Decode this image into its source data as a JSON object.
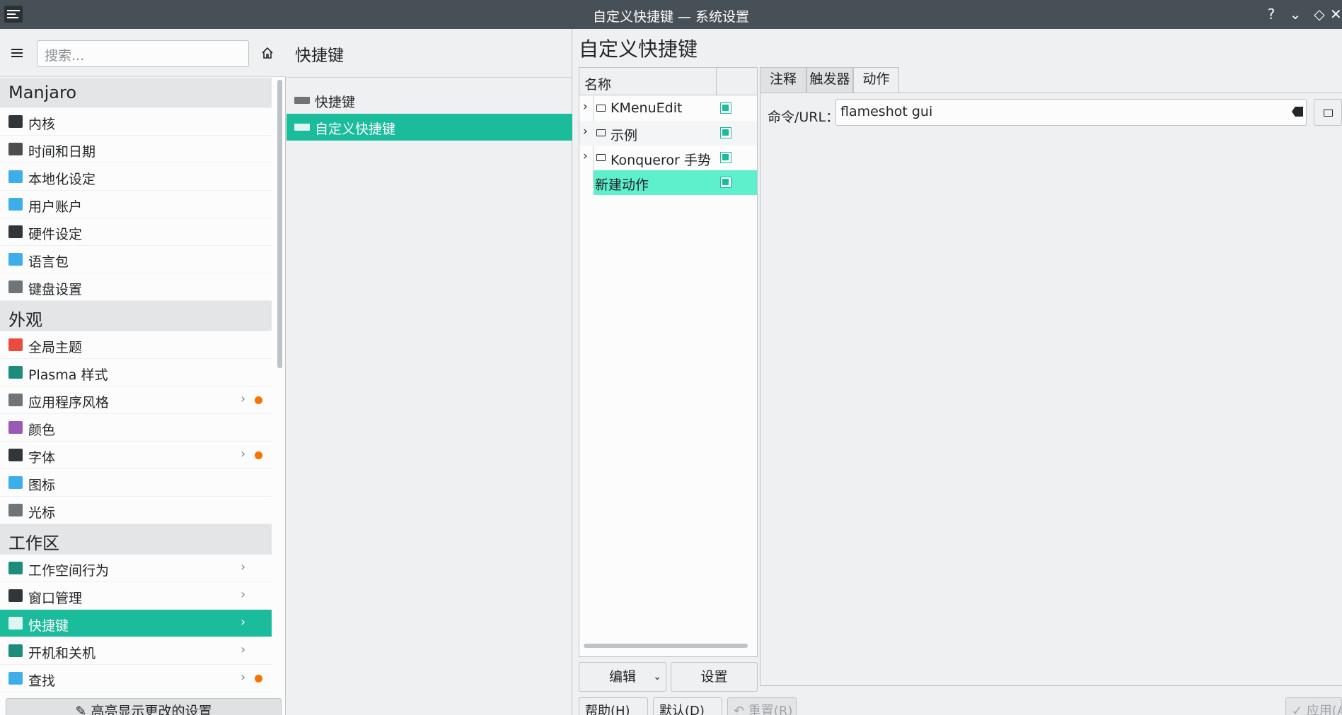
{
  "window": {
    "title": "自定义快捷键 — 系统设置",
    "help_glyph": "?",
    "minimize_glyph": "⌄",
    "maximize_glyph": "◇",
    "close_glyph": "✕"
  },
  "sidebar": {
    "search_placeholder": "搜索...",
    "categories": [
      {
        "title": "Manjaro",
        "items": [
          {
            "label": "内核",
            "icon": "kernel-icon",
            "color": "#31363b"
          },
          {
            "label": "时间和日期",
            "icon": "clock-icon",
            "color": "#4d4d4d"
          },
          {
            "label": "本地化设定",
            "icon": "locale-icon",
            "color": "#3daee9"
          },
          {
            "label": "用户账户",
            "icon": "user-icon",
            "color": "#3daee9"
          },
          {
            "label": "硬件设定",
            "icon": "hardware-icon",
            "color": "#31363b"
          },
          {
            "label": "语言包",
            "icon": "language-icon",
            "color": "#3daee9"
          },
          {
            "label": "键盘设置",
            "icon": "keyboard-icon",
            "color": "#6e7478"
          }
        ]
      },
      {
        "title": "外观",
        "items": [
          {
            "label": "全局主题",
            "icon": "global-theme-icon",
            "color": "#e74c3c"
          },
          {
            "label": "Plasma 样式",
            "icon": "plasma-style-icon",
            "color": "#1d8c7a"
          },
          {
            "label": "应用程序风格",
            "icon": "app-style-icon",
            "color": "#6e7478",
            "chevron": true,
            "dot": true
          },
          {
            "label": "颜色",
            "icon": "colors-icon",
            "color": "#9b59b6"
          },
          {
            "label": "字体",
            "icon": "font-icon",
            "color": "#31363b",
            "chevron": true,
            "dot": true
          },
          {
            "label": "图标",
            "icon": "icons-icon",
            "color": "#3daee9"
          },
          {
            "label": "光标",
            "icon": "cursor-icon",
            "color": "#6e7478"
          }
        ]
      },
      {
        "title": "工作区",
        "items": [
          {
            "label": "工作空间行为",
            "icon": "workspace-icon",
            "color": "#1d8c7a",
            "chevron": true
          },
          {
            "label": "窗口管理",
            "icon": "window-icon",
            "color": "#31363b",
            "chevron": true
          },
          {
            "label": "快捷键",
            "icon": "shortcuts-icon",
            "color": "#dff5ef",
            "chevron": true,
            "selected": true
          },
          {
            "label": "开机和关机",
            "icon": "startup-icon",
            "color": "#1d8c7a",
            "chevron": true
          },
          {
            "label": "查找",
            "icon": "search-icon",
            "color": "#3daee9",
            "chevron": true,
            "dot": true
          }
        ]
      }
    ],
    "chevron_glyph": "›",
    "highlight_button": "✎ 高亮显示更改的设置"
  },
  "middle": {
    "title": "快捷键",
    "items": [
      {
        "label": "快捷键",
        "selected": false
      },
      {
        "label": "自定义快捷键",
        "selected": true
      }
    ]
  },
  "main": {
    "title": "自定义快捷键",
    "tree": {
      "column_name": "名称",
      "rows": [
        {
          "name": "KMenuEdit",
          "folder": true,
          "checked": true
        },
        {
          "name": "示例",
          "folder": true,
          "checked": true
        },
        {
          "name": "Konqueror 手势",
          "folder": true,
          "checked": true
        },
        {
          "name": "新建动作",
          "folder": false,
          "checked": true,
          "selected": true
        }
      ],
      "expand_glyph": "›"
    },
    "edit_button": "编辑",
    "edit_arrow": "⌄",
    "settings_button": "设置",
    "tabs": [
      {
        "label": "注释",
        "active": false
      },
      {
        "label": "触发器",
        "active": false
      },
      {
        "label": "动作",
        "active": true
      }
    ],
    "command_label": "命令/URL：",
    "command_value": "flameshot gui"
  },
  "footer": {
    "help_button": "帮助(H)",
    "default_button": "默认(D)",
    "reset_button": "↶ 重置(R)",
    "apply_button": "✓ 应用(A)"
  },
  "colors": {
    "accent": "#1abc9c",
    "selection_light": "#5ef0cd",
    "notification_dot": "#f67400"
  }
}
